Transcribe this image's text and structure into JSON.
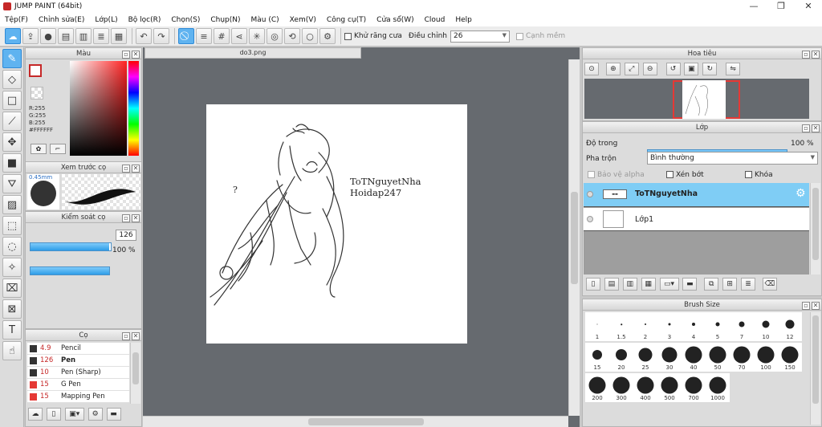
{
  "window": {
    "title": "JUMP PAINT (64bit)",
    "min": "—",
    "max": "❐",
    "close": "✕"
  },
  "menu": [
    "Tệp(F)",
    "Chỉnh sửa(E)",
    "Lớp(L)",
    "Bộ lọc(R)",
    "Chọn(S)",
    "Chụp(N)",
    "Màu (C)",
    "Xem(V)",
    "Công cụ(T)",
    "Cửa sổ(W)",
    "Cloud",
    "Help"
  ],
  "toolbar": {
    "antialias_label": "Khử răng cưa",
    "adjust_label": "Điều chỉnh",
    "adjust_value": "26",
    "edge_label": "Cạnh mềm"
  },
  "color_panel": {
    "title": "Màu",
    "r": "R:255",
    "g": "G:255",
    "b": "B:255",
    "hex": "#FFFFFF",
    "fg": "#ffffff",
    "border": "#c62828"
  },
  "preview_panel": {
    "title": "Xem trước cọ",
    "size_label": "0.45mm"
  },
  "control_panel": {
    "title": "Kiểm soát cọ",
    "size_value": "126",
    "opacity_value": "100 %",
    "size_fraction": 0.98,
    "opacity_fraction": 1.0
  },
  "brush_panel": {
    "title": "Cọ",
    "items": [
      {
        "size": "4.9",
        "name": "Pencil",
        "color": "#333333",
        "selected": false
      },
      {
        "size": "126",
        "name": "Pen",
        "color": "#333333",
        "selected": true
      },
      {
        "size": "10",
        "name": "Pen (Sharp)",
        "color": "#333333",
        "selected": false
      },
      {
        "size": "15",
        "name": "G Pen",
        "color": "#e53935",
        "selected": false
      },
      {
        "size": "15",
        "name": "Mapping Pen",
        "color": "#e53935",
        "selected": false
      }
    ]
  },
  "document": {
    "tab": "do3.png",
    "text_line1": "ToTNguyetNha",
    "text_line2": "Hoidap247",
    "question": "?"
  },
  "navigator": {
    "title": "Hoa tiêu"
  },
  "layer_panel": {
    "title": "Lớp",
    "opacity_label": "Độ trong",
    "opacity_value": "100 %",
    "opacity_fraction": 1.0,
    "blend_label": "Pha trộn",
    "blend_value": "Bình thường",
    "protect_alpha": "Bảo vệ alpha",
    "clipping": "Xén bớt",
    "lock": "Khóa",
    "layers": [
      {
        "name": "ToTNguyetNha",
        "selected": true
      },
      {
        "name": "Lớp1",
        "selected": false
      }
    ]
  },
  "brush_size_panel": {
    "title": "Brush Size",
    "sizes": [
      "1",
      "1.5",
      "2",
      "3",
      "4",
      "5",
      "7",
      "10",
      "12",
      "15",
      "20",
      "25",
      "30",
      "40",
      "50",
      "70",
      "100",
      "150",
      "200",
      "300",
      "400",
      "500",
      "700",
      "1000"
    ],
    "dot_sizes": [
      1,
      1.5,
      2,
      3,
      4,
      5,
      7,
      9,
      11,
      12,
      14,
      17,
      19,
      21,
      21,
      21,
      21,
      21,
      21,
      21,
      21,
      21,
      21,
      21
    ]
  }
}
